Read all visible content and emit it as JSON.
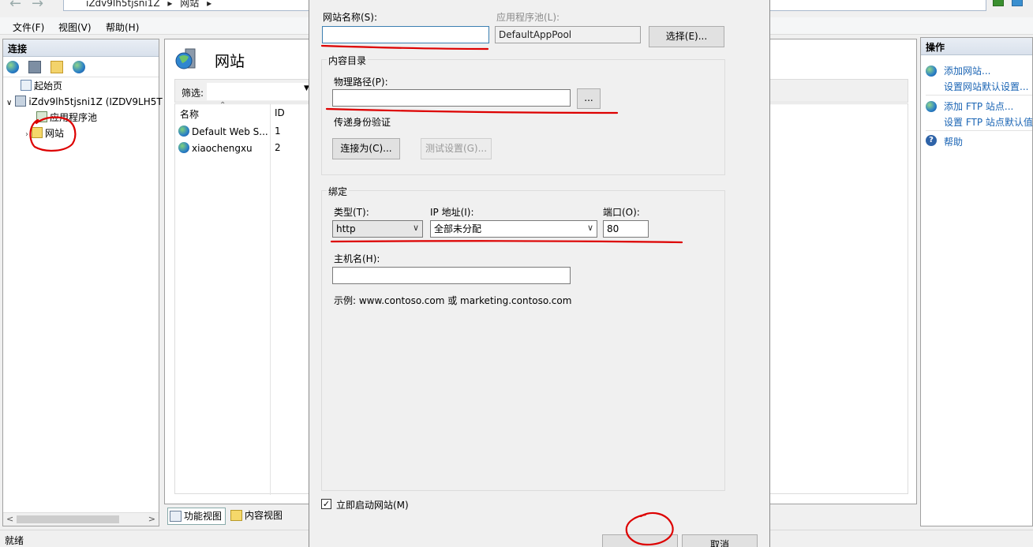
{
  "address": {
    "segments": [
      "iZdv9lh5tjsni1Z",
      "网站"
    ]
  },
  "menu": {
    "file": "文件(F)",
    "view": "视图(V)",
    "help": "帮助(H)"
  },
  "connections": {
    "header": "连接",
    "tree": {
      "start": "起始页",
      "server": "iZdv9lh5tjsni1Z (IZDV9LH5T",
      "app_pools": "应用程序池",
      "sites": "网站"
    }
  },
  "center": {
    "title": "网站",
    "filter_label": "筛选:",
    "columns": {
      "name": "名称",
      "id": "ID"
    },
    "rows": [
      {
        "name": "Default Web S...",
        "id": "1"
      },
      {
        "name": "xiaochengxu",
        "id": "2"
      }
    ],
    "tabs": {
      "features": "功能视图",
      "content": "内容视图"
    }
  },
  "actions": {
    "header": "操作",
    "add_site": "添加网站...",
    "site_defaults": "设置网站默认设置...",
    "add_ftp": "添加 FTP 站点...",
    "ftp_defaults": "设置 FTP 站点默认值",
    "help": "帮助"
  },
  "status": {
    "text": "就绪"
  },
  "dialog": {
    "site_name_label": "网站名称(S):",
    "site_name_value": "",
    "app_pool_label": "应用程序池(L):",
    "app_pool_value": "DefaultAppPool",
    "select_button": "选择(E)...",
    "content_dir_title": "内容目录",
    "physical_path_label": "物理路径(P):",
    "physical_path_value": "",
    "browse_button": "...",
    "passthrough_label": "传递身份验证",
    "connect_as_button": "连接为(C)...",
    "test_settings_button": "测试设置(G)...",
    "binding_title": "绑定",
    "type_label": "类型(T):",
    "type_value": "http",
    "ip_label": "IP 地址(I):",
    "ip_value": "全部未分配",
    "port_label": "端口(O):",
    "port_value": "80",
    "hostname_label": "主机名(H):",
    "hostname_value": "",
    "example_text": "示例: www.contoso.com 或 marketing.contoso.com",
    "start_now_label": "立即启动网站(M)",
    "start_now_checked": true,
    "cancel_button": "取消"
  },
  "colors": {
    "annotation": "#dd0000",
    "link": "#1a64b4"
  }
}
